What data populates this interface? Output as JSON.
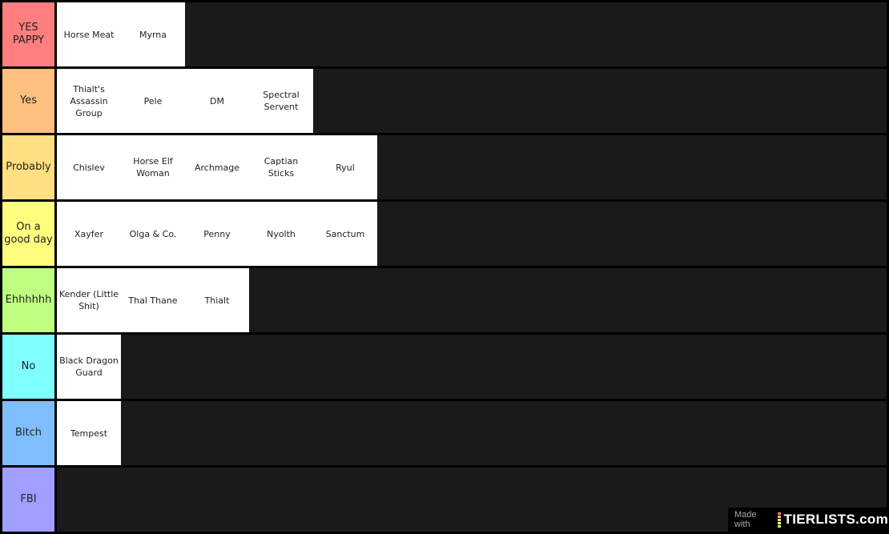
{
  "tiers": [
    {
      "label": "YES PAPPY",
      "color": "#ff7f7f",
      "items": [
        "Horse Meat",
        "Myrna"
      ]
    },
    {
      "label": "Yes",
      "color": "#ffbf7f",
      "items": [
        "Thialt's Assassin Group",
        "Pele",
        "DM",
        "Spectral Servent"
      ]
    },
    {
      "label": "Probably",
      "color": "#ffdf7f",
      "items": [
        "Chislev",
        "Horse Elf Woman",
        "Archmage",
        "Captian Sticks",
        "Ryul"
      ]
    },
    {
      "label": "On a good day",
      "color": "#ffff7f",
      "items": [
        "Xayfer",
        "Olga & Co.",
        "Penny",
        "Nyolth",
        "Sanctum"
      ]
    },
    {
      "label": "Ehhhhhh",
      "color": "#bfff7f",
      "items": [
        "Kender (Little Shit)",
        "Thal Thane",
        "Thialt"
      ]
    },
    {
      "label": "No",
      "color": "#7fffff",
      "items": [
        "Black Dragon Guard"
      ]
    },
    {
      "label": "Bitch",
      "color": "#7fbfff",
      "items": [
        "Tempest"
      ]
    },
    {
      "label": "FBI",
      "color": "#9f9fff",
      "items": []
    }
  ],
  "watermark": {
    "made_with": "Made with",
    "brand": "TIERLISTS.com"
  }
}
